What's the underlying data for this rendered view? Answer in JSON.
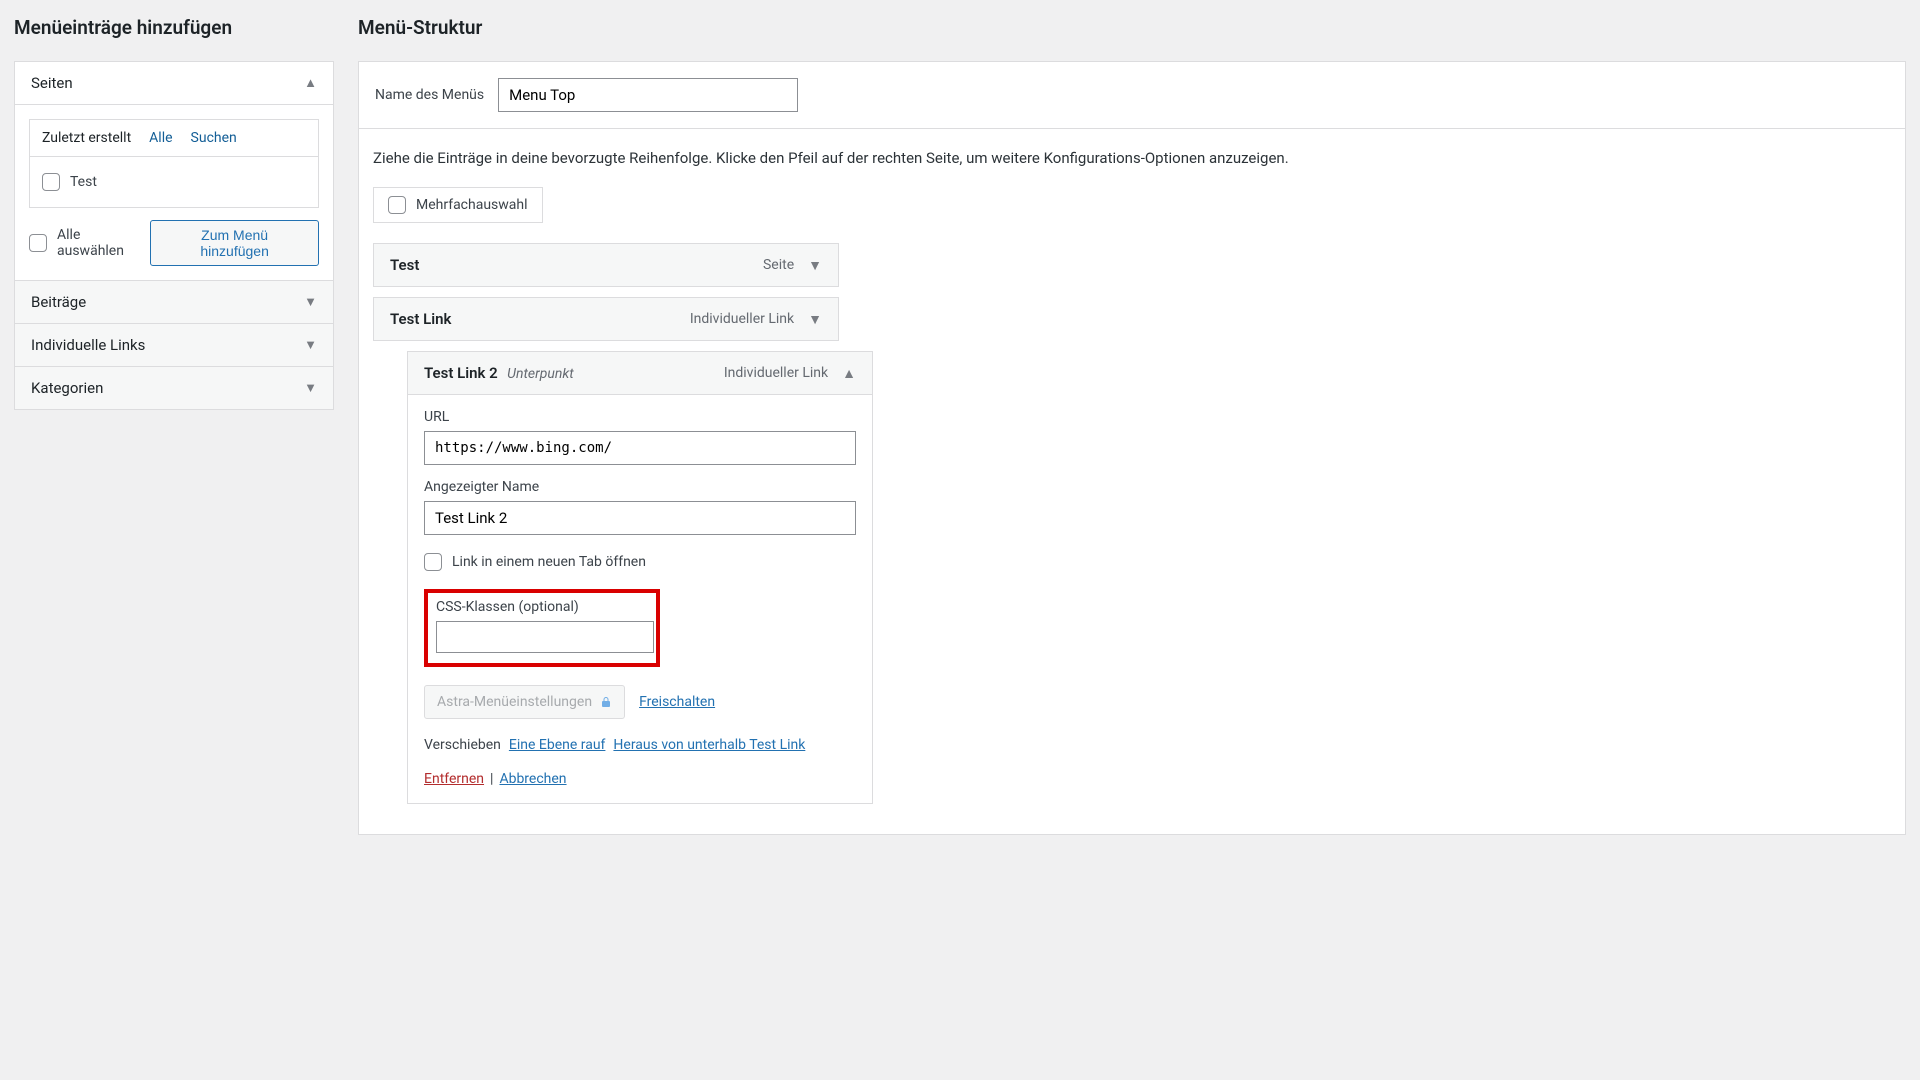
{
  "left": {
    "title": "Menüeinträge hinzufügen",
    "acc_pages": "Seiten",
    "tabs": {
      "recent": "Zuletzt erstellt",
      "all": "Alle",
      "search": "Suchen"
    },
    "page_item": "Test",
    "select_all": "Alle auswählen",
    "add_btn": "Zum Menü hinzufügen",
    "acc_posts": "Beiträge",
    "acc_links": "Individuelle Links",
    "acc_cats": "Kategorien"
  },
  "right": {
    "title": "Menü-Struktur",
    "name_label": "Name des Menüs",
    "name_value": "Menu Top",
    "instructions": "Ziehe die Einträge in deine bevorzugte Reihenfolge. Klicke den Pfeil auf der rechten Seite, um weitere Konfigurations-Optionen anzuzeigen.",
    "bulk_label": "Mehrfachauswahl",
    "items": {
      "i1": {
        "title": "Test",
        "type": "Seite"
      },
      "i2": {
        "title": "Test Link",
        "type": "Individueller Link"
      },
      "i3": {
        "title": "Test Link 2",
        "sub": "Unterpunkt",
        "type": "Individueller Link",
        "url_label": "URL",
        "url_value": "https://www.bing.com/",
        "name_label": "Angezeigter Name",
        "name_value": "Test Link 2",
        "newtab_label": "Link in einem neuen Tab öffnen",
        "css_label": "CSS-Klassen (optional)",
        "css_value": "",
        "astra_label": "Astra-Menüeinstellungen",
        "unlock_label": "Freischalten",
        "move_label": "Verschieben",
        "move_up": "Eine Ebene rauf",
        "move_out": "Heraus von unterhalb Test Link",
        "remove": "Entfernen",
        "cancel": "Abbrechen"
      }
    }
  }
}
